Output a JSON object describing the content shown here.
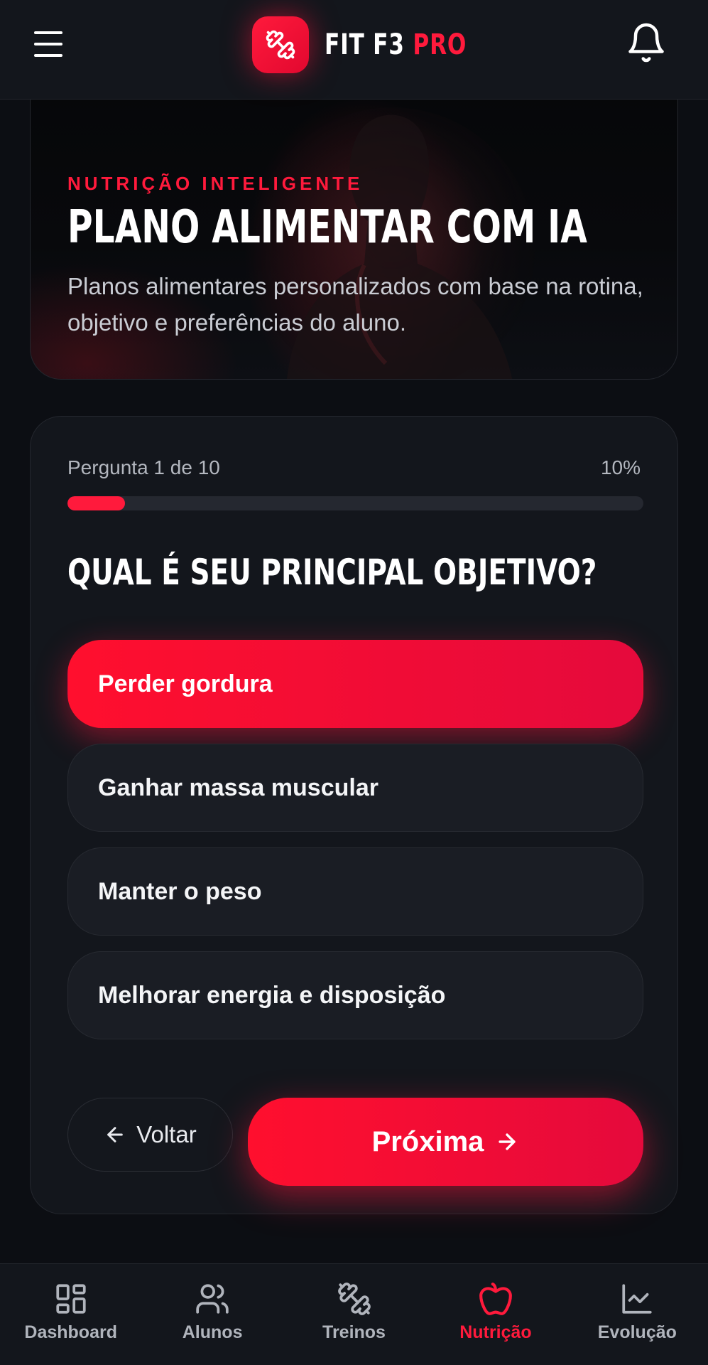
{
  "header": {
    "brand_main": "FIT F3",
    "brand_accent": "PRO",
    "accent_color": "#ff1a3c"
  },
  "hero": {
    "eyebrow": "NUTRIÇÃO INTELIGENTE",
    "title": "PLANO ALIMENTAR COM IA",
    "description": "Planos alimentares personalizados com base na rotina, objetivo e preferências do aluno."
  },
  "quiz": {
    "counter": "Pergunta 1 de 10",
    "percent_label": "10%",
    "progress": 0.1,
    "question": "QUAL É SEU PRINCIPAL OBJETIVO?",
    "options": [
      {
        "label": "Perder gordura",
        "selected": true
      },
      {
        "label": "Ganhar massa muscular",
        "selected": false
      },
      {
        "label": "Manter o peso",
        "selected": false
      },
      {
        "label": "Melhorar energia e disposição",
        "selected": false
      }
    ],
    "back_label": "Voltar",
    "next_label": "Próxima"
  },
  "nav": {
    "items": [
      {
        "label": "Dashboard",
        "icon": "dashboard-icon",
        "active": false
      },
      {
        "label": "Alunos",
        "icon": "users-icon",
        "active": false
      },
      {
        "label": "Treinos",
        "icon": "dumbbell-icon",
        "active": false
      },
      {
        "label": "Nutrição",
        "icon": "apple-icon",
        "active": true
      },
      {
        "label": "Evolução",
        "icon": "chart-line-icon",
        "active": false
      }
    ]
  }
}
